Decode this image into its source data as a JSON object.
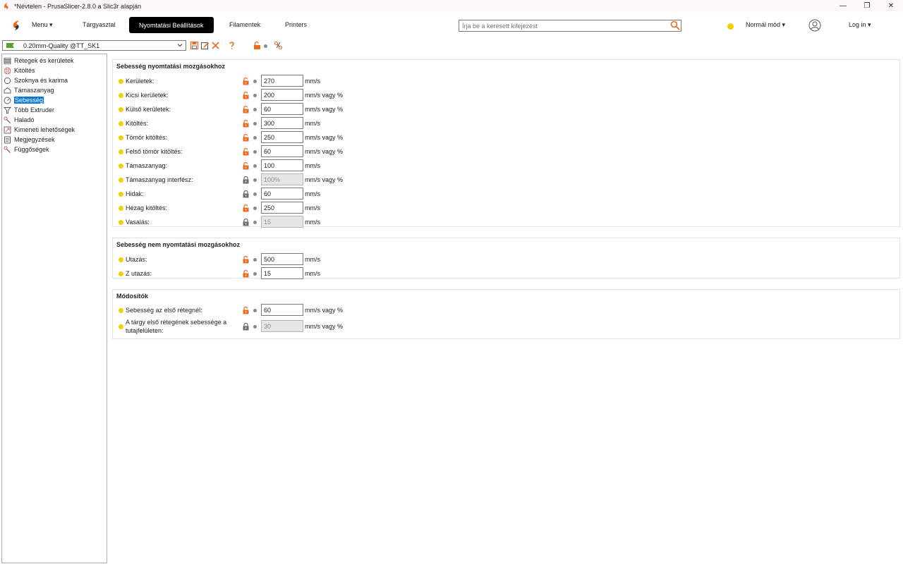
{
  "window": {
    "title": "*Névtelen - PrusaSlicer-2.8.0 a Slic3r alapján",
    "minimize": "—",
    "maximize": "❐",
    "close": "✕"
  },
  "topbar": {
    "menu": "Menu ▾",
    "tabs": [
      "Tárgyasztal",
      "Nyomtatási Beállítások",
      "Filamentek",
      "Printers"
    ],
    "search_placeholder": "Írja be a keresett kifejezést",
    "mode": "Normál mód ▾",
    "login": "Log in ▾"
  },
  "preset": {
    "value": "0.20mm-Quality @TT_SK1"
  },
  "sidebar": {
    "items": [
      {
        "label": "Rétegek és kerületek",
        "icon": "layers-icon"
      },
      {
        "label": "Kitöltés",
        "icon": "infill-icon"
      },
      {
        "label": "Szoknya és karima",
        "icon": "skirt-icon"
      },
      {
        "label": "Támaszanyag",
        "icon": "support-icon"
      },
      {
        "label": "Sebesség",
        "icon": "speed-icon"
      },
      {
        "label": "Több Extruder",
        "icon": "funnel-icon"
      },
      {
        "label": "Haladó",
        "icon": "wrench-icon"
      },
      {
        "label": "Kimeneti lehetőségek",
        "icon": "output-icon"
      },
      {
        "label": "Megjegyzések",
        "icon": "notes-icon"
      },
      {
        "label": "Függőségek",
        "icon": "dependencies-icon"
      }
    ],
    "selected": 4
  },
  "groups": [
    {
      "title": "Sebesség nyomtatási mozgásokhoz",
      "rows": [
        {
          "label": "Kerületek:",
          "value": "270",
          "unit": "mm/s",
          "locked": false,
          "disabled": false
        },
        {
          "label": "Kicsi kerületek:",
          "value": "200",
          "unit": "mm/s vagy %",
          "locked": false,
          "disabled": false
        },
        {
          "label": "Külső kerületek:",
          "value": "60",
          "unit": "mm/s vagy %",
          "locked": false,
          "disabled": false
        },
        {
          "label": "Kitöltés:",
          "value": "300",
          "unit": "mm/s",
          "locked": false,
          "disabled": false
        },
        {
          "label": "Tömör kitöltés:",
          "value": "250",
          "unit": "mm/s vagy %",
          "locked": false,
          "disabled": false
        },
        {
          "label": "Felső tömör kitöltés:",
          "value": "60",
          "unit": "mm/s vagy %",
          "locked": false,
          "disabled": false
        },
        {
          "label": "Támaszanyag:",
          "value": "100",
          "unit": "mm/s",
          "locked": false,
          "disabled": false
        },
        {
          "label": "Támaszanyag interfész:",
          "value": "100%",
          "unit": "mm/s vagy %",
          "locked": true,
          "disabled": true
        },
        {
          "label": "Hidak:",
          "value": "60",
          "unit": "mm/s",
          "locked": true,
          "disabled": false
        },
        {
          "label": "Hézag kitöltés:",
          "value": "250",
          "unit": "mm/s",
          "locked": false,
          "disabled": false
        },
        {
          "label": "Vasalás:",
          "value": "15",
          "unit": "mm/s",
          "locked": true,
          "disabled": true
        }
      ]
    },
    {
      "title": "Sebesség nem nyomtatási mozgásokhoz",
      "rows": [
        {
          "label": "Utazás:",
          "value": "500",
          "unit": "mm/s",
          "locked": false,
          "disabled": false
        },
        {
          "label": "Z utazás:",
          "value": "15",
          "unit": "mm/s",
          "locked": false,
          "disabled": false
        }
      ]
    },
    {
      "title": "Módosítók",
      "rows": [
        {
          "label": "Sebesség az első rétegnél:",
          "value": "60",
          "unit": "mm/s vagy %",
          "locked": false,
          "disabled": false
        },
        {
          "label": "A tárgy első rétegének sebessége a tutajfelületen:",
          "value": "30",
          "unit": "mm/s vagy %",
          "locked": true,
          "disabled": true
        }
      ]
    }
  ],
  "colors": {
    "accent": "#ed6b21",
    "mode_dot": "#f5d000",
    "selection": "#0078d7",
    "locked_grey": "#7a7a7a"
  }
}
